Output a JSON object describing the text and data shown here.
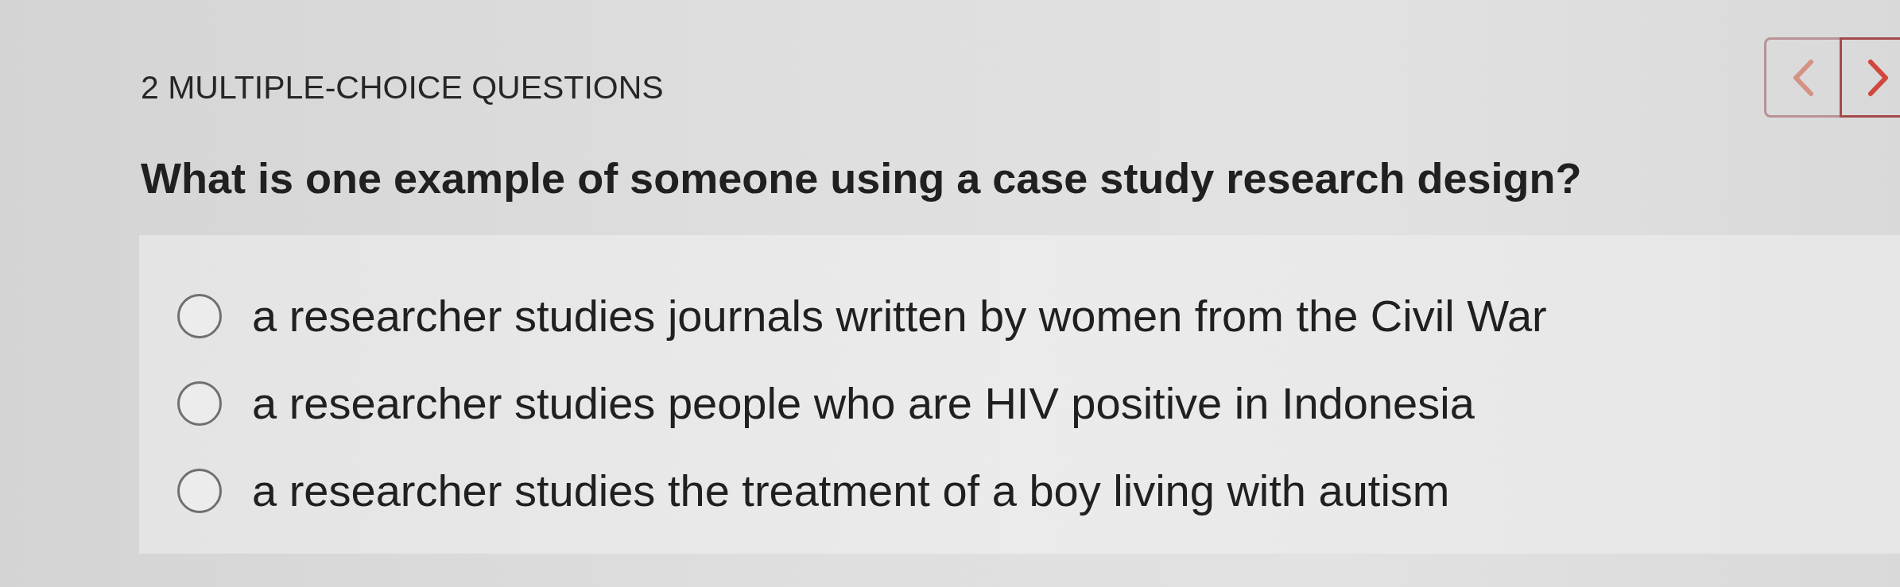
{
  "section": {
    "title": "2 MULTIPLE-CHOICE QUESTIONS"
  },
  "navigation": [
    {
      "kind": "previous",
      "disabled": true
    },
    {
      "kind": "next",
      "disabled": false
    }
  ],
  "question": {
    "text": "What is one example of someone using a case study research design?"
  },
  "options": [
    {
      "label": "a researcher studies journals written by women from the Civil War",
      "selected": false
    },
    {
      "label": "a researcher studies people who are HIV positive in Indonesia",
      "selected": false
    },
    {
      "label": "a researcher studies the treatment of a boy living with autism",
      "selected": false
    }
  ]
}
